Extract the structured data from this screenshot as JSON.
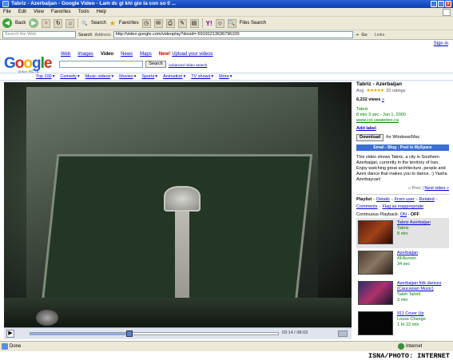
{
  "window": {
    "title": "Tabriz - Azerbaijan - Google Video - Lam dc gi khi gio la con so 0 ..."
  },
  "menu": [
    "File",
    "Edit",
    "View",
    "Favorites",
    "Tools",
    "Help"
  ],
  "toolbar": {
    "back": "Back",
    "search": "Search",
    "favorites": "Favorites",
    "files_search": "Files Search"
  },
  "addressbar": {
    "search_web_placeholder": "Search the Web",
    "search_label": "Search",
    "address_label": "Address",
    "url": "http://video.google.com/videoplay?docid=-59191213636796100",
    "go": "Go",
    "links": "Links"
  },
  "page": {
    "signin": "Sign in",
    "logo_sub": "Video BETA",
    "tabs": [
      "Web",
      "Images",
      "Video",
      "News",
      "Maps"
    ],
    "new_tag": "New!",
    "upload": "Upload your videos",
    "search_button": "Search",
    "advanced": "Advanced Video Search",
    "categories": [
      "Top 100",
      "Comedy",
      "Music videos",
      "Movies",
      "Sports",
      "Animation",
      "TV shows",
      "More"
    ]
  },
  "player": {
    "time": "03:14 / 08:03",
    "progress_fraction": 0.4
  },
  "video_info": {
    "title": "Tabriz - Azerbaijan",
    "avg_label": "Avg",
    "stars": "★★★★★",
    "ratings": "20 ratings",
    "views": "6,232 views",
    "channel": "Tabriz",
    "meta": "8 min 3 sec - Jun 1, 2000",
    "url": "www.cst.uwaterloo.ca",
    "add_label": "Add label",
    "download": "Download",
    "for_platform": "for Windows/Mac",
    "share": "Email - Blog - Post to MySpace",
    "description": "This video shows Tabriz, a city in Southern Azerbaijan, currently in the territory of Iran. Enjoy watching great architecture, people and Azeri dance that makes you to dance. :) Yasha Azerbaycan!",
    "prev": "« Prev",
    "next": "Next video »"
  },
  "playlist_bar": {
    "label": "Playlist",
    "links": [
      "Details",
      "From user",
      "Related",
      "Comments",
      "Flag as inappropriate"
    ],
    "continuous_label": "Continuous Playback:",
    "on": "ON",
    "off": "OFF"
  },
  "playlist": [
    {
      "title": "Tabriz Azerbaijan",
      "source": "Tabriz",
      "duration": "8 min"
    },
    {
      "title": "Azerbaijan",
      "source": "AFAunion",
      "duration": "34 sec"
    },
    {
      "title": "Azerbaijan folk dances (Caucasian Music)",
      "source": "Taleh Tahirli",
      "duration": "3 min"
    },
    {
      "title": "911 Cover Up",
      "source": "Loose Change",
      "duration": "1 hr 22 min"
    }
  ],
  "status": {
    "text": "Done",
    "zone": "Internet"
  },
  "credit": "ISNA/PHOTO: INTERNET"
}
